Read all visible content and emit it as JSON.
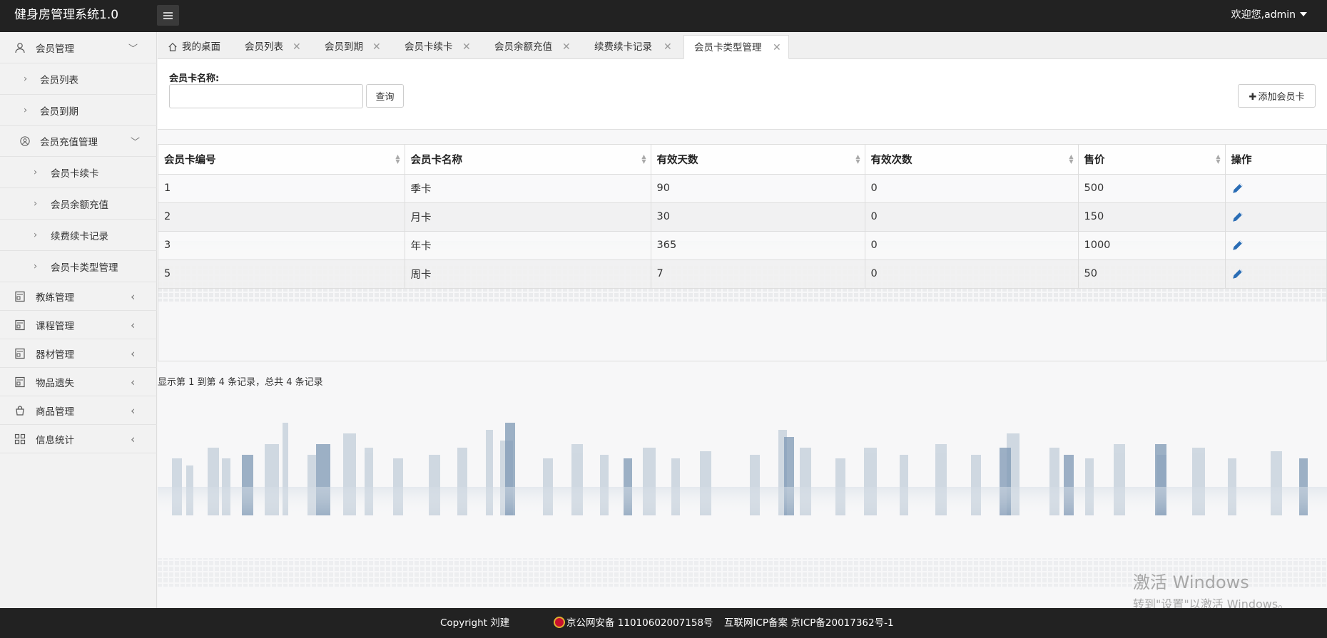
{
  "header": {
    "app_title": "健身房管理系统1.0",
    "user_menu": "欢迎您,admin"
  },
  "sidebar": {
    "items": [
      {
        "label": "会员管理",
        "icon": "user-icon"
      },
      {
        "label": "会员列表"
      },
      {
        "label": "会员到期"
      },
      {
        "label": "会员充值管理",
        "icon": "user-circle-icon"
      },
      {
        "label": "会员卡续卡"
      },
      {
        "label": "会员余额充值"
      },
      {
        "label": "续费续卡记录"
      },
      {
        "label": "会员卡类型管理"
      },
      {
        "label": "教练管理",
        "icon": "id-card-icon"
      },
      {
        "label": "课程管理",
        "icon": "id-card-icon"
      },
      {
        "label": "器材管理",
        "icon": "id-card-icon"
      },
      {
        "label": "物品遗失",
        "icon": "id-card-icon"
      },
      {
        "label": "商品管理",
        "icon": "shopping-bag-icon"
      },
      {
        "label": "信息统计",
        "icon": "grid-icon"
      }
    ]
  },
  "tabs": [
    {
      "label": "我的桌面",
      "icon": "home-icon"
    },
    {
      "label": "会员列表"
    },
    {
      "label": "会员到期"
    },
    {
      "label": "会员卡续卡"
    },
    {
      "label": "会员余额充值"
    },
    {
      "label": "续费续卡记录"
    },
    {
      "label": "会员卡类型管理",
      "active": true
    }
  ],
  "search": {
    "label": "会员卡名称:",
    "value": "",
    "query_button": "查询",
    "add_button": "添加会员卡"
  },
  "table": {
    "columns": [
      "会员卡编号",
      "会员卡名称",
      "有效天数",
      "有效次数",
      "售价",
      "操作"
    ],
    "rows": [
      [
        "1",
        "季卡",
        "90",
        "0",
        "500"
      ],
      [
        "2",
        "月卡",
        "30",
        "0",
        "150"
      ],
      [
        "3",
        "年卡",
        "365",
        "0",
        "1000"
      ],
      [
        "5",
        "周卡",
        "7",
        "0",
        "50"
      ]
    ]
  },
  "summary": "显示第 1 到第 4 条记录，总共 4 条记录",
  "watermark": {
    "title": "激活 Windows",
    "subtitle": "转到\"设置\"以激活 Windows。"
  },
  "footer": {
    "copyright": "Copyright 刘建",
    "police": "京公网安备 11010602007158号",
    "icp": "互联网ICP备案 京ICP备20017362号-1"
  },
  "colors": {
    "topbar": "#222222",
    "sidebar": "#f2f2f2",
    "edit_icon": "#2a6db5"
  }
}
